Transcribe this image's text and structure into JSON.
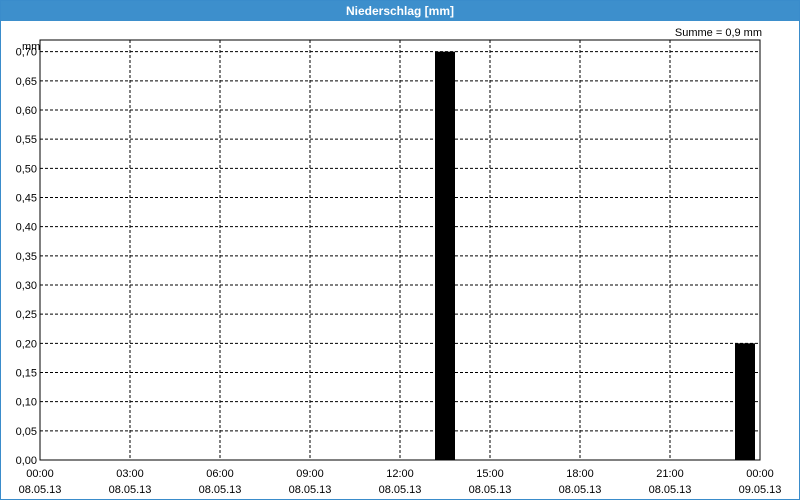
{
  "window": {
    "title": "Niederschlag [mm]"
  },
  "annotation": "Summe = 0,9 mm",
  "chart_data": {
    "type": "bar",
    "title": "Niederschlag [mm]",
    "ylabel": "mm",
    "ylim": [
      0,
      0.7
    ],
    "yticks": [
      "0,00",
      "0,05",
      "0,10",
      "0,15",
      "0,20",
      "0,25",
      "0,30",
      "0,35",
      "0,40",
      "0,45",
      "0,50",
      "0,55",
      "0,60",
      "0,65",
      "0,70"
    ],
    "xlim_hours": [
      0,
      24
    ],
    "xticks": [
      {
        "time": "00:00",
        "date": "08.05.13"
      },
      {
        "time": "03:00",
        "date": "08.05.13"
      },
      {
        "time": "06:00",
        "date": "08.05.13"
      },
      {
        "time": "09:00",
        "date": "08.05.13"
      },
      {
        "time": "12:00",
        "date": "08.05.13"
      },
      {
        "time": "15:00",
        "date": "08.05.13"
      },
      {
        "time": "18:00",
        "date": "08.05.13"
      },
      {
        "time": "21:00",
        "date": "08.05.13"
      },
      {
        "time": "00:00",
        "date": "09.05.13"
      }
    ],
    "bars": [
      {
        "x_hours": 13.5,
        "value": 0.7
      },
      {
        "x_hours": 23.5,
        "value": 0.2
      }
    ],
    "bar_color": "#000000",
    "grid": true
  }
}
